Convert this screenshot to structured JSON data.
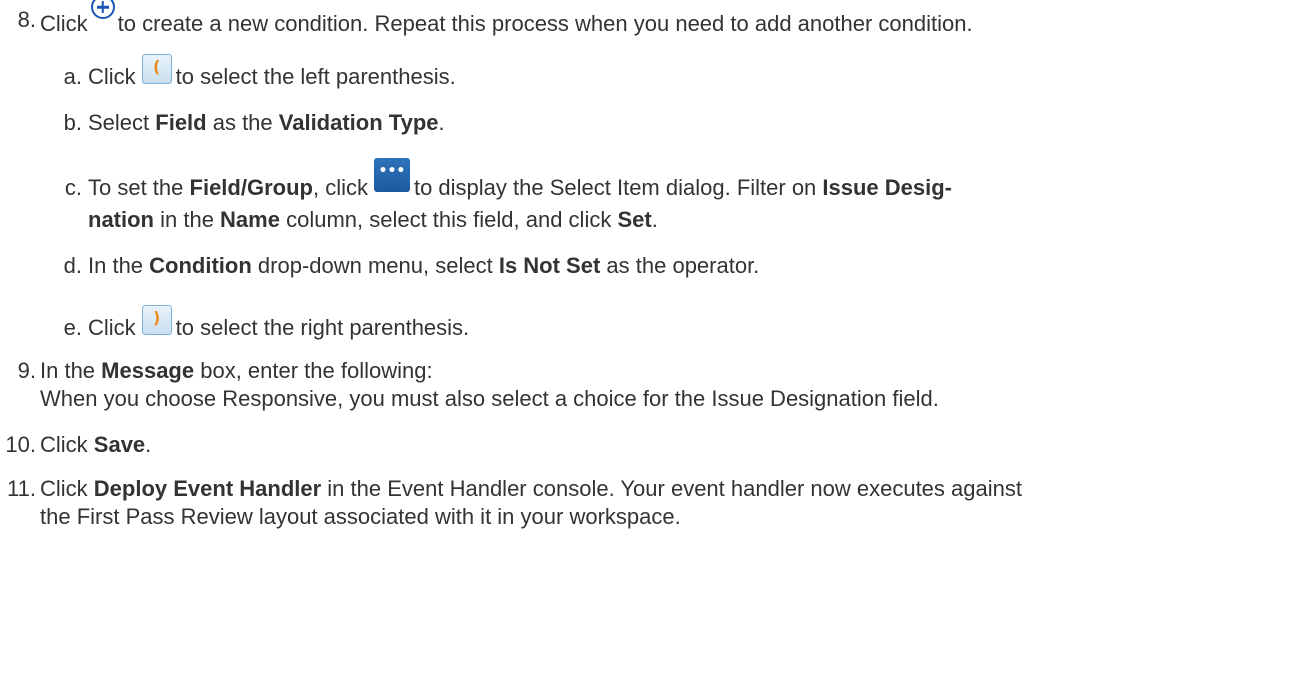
{
  "steps": {
    "s8": {
      "num": "8.",
      "pre": "Click",
      "post": "to create a new condition. Repeat this process when you need to add another condition."
    },
    "s8a": {
      "num": "a.",
      "pre": "Click",
      "icon": "(",
      "post": "to select the left parenthesis."
    },
    "s8b": {
      "num": "b.",
      "t1": "Select ",
      "b1": "Field",
      "t2": " as the ",
      "b2": "Validation Type",
      "t3": "."
    },
    "s8c": {
      "num": "c.",
      "t1": "To set the ",
      "b1": "Field/Group",
      "t2": ", click",
      "icon": "•••",
      "t3": "to display the Select Item dialog. Filter on ",
      "b2": "Issue Desig-",
      "l2_b1": "nation",
      "l2_t1": " in the ",
      "l2_b2": "Name",
      "l2_t2": " column, select this field, and click ",
      "l2_b3": "Set",
      "l2_t3": "."
    },
    "s8d": {
      "num": "d.",
      "t1": "In the ",
      "b1": "Condition",
      "t2": " drop-down menu, select ",
      "b2": "Is Not Set",
      "t3": " as the operator."
    },
    "s8e": {
      "num": "e.",
      "pre": "Click",
      "icon": ")",
      "post": "to select the right parenthesis."
    },
    "s9": {
      "num": "9.",
      "t1": "In the ",
      "b1": "Message",
      "t2": " box, enter the following:",
      "line2": "When you choose Responsive, you must also select a choice for the Issue Designation field."
    },
    "s10": {
      "num": "10.",
      "t1": "Click ",
      "b1": "Save",
      "t2": "."
    },
    "s11": {
      "num": "11.",
      "t1": "Click ",
      "b1": "Deploy Event Handler",
      "t2": " in the Event Handler console. Your event handler now executes against",
      "line2": "the First Pass Review layout associated with it in your workspace."
    }
  },
  "colors": {
    "text": "#333333",
    "plus_icon": "#1a55b6",
    "paren_text": "#e88b1e",
    "paren_bg": "#c9dff0",
    "dots_bg": "#1c5a9f"
  }
}
